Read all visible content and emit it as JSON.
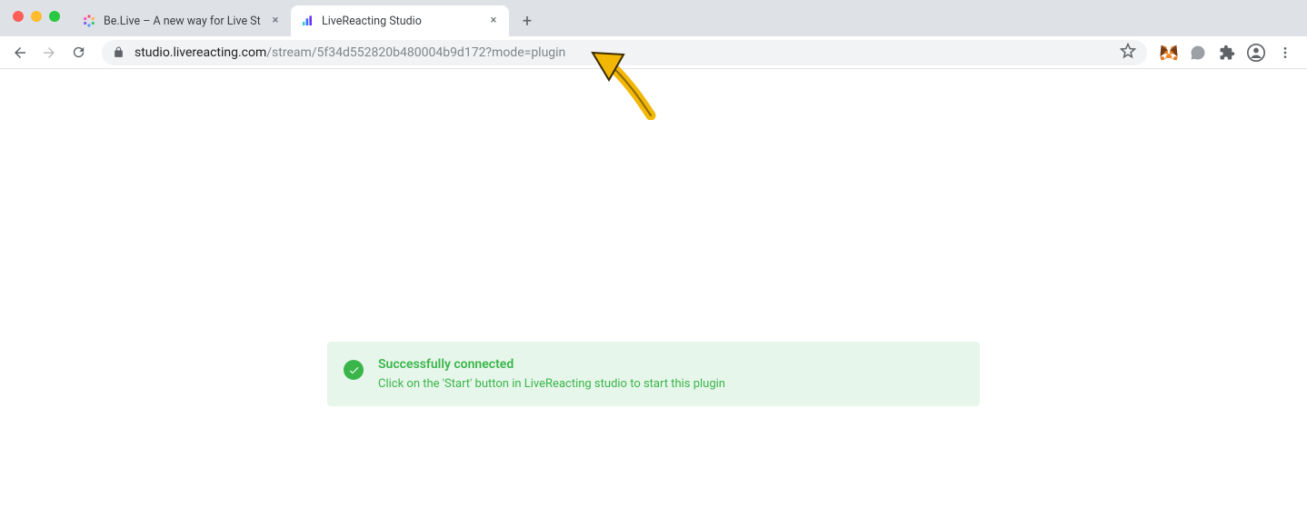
{
  "tabs": [
    {
      "title": "Be.Live – A new way for Live St",
      "active": false
    },
    {
      "title": "LiveReacting Studio",
      "active": true
    }
  ],
  "url": {
    "host": "studio.livereacting.com",
    "path": "/stream/5f34d552820b480004b9d172?mode=plugin"
  },
  "status": {
    "title": "Successfully connected",
    "subtitle": "Click on the 'Start' button in LiveReacting studio to start this plugin"
  },
  "icons": {
    "close": "×",
    "plus": "+",
    "back": "back-arrow-icon",
    "forward": "forward-arrow-icon",
    "reload": "reload-icon",
    "lock": "lock-icon",
    "star": "star-icon",
    "metamask": "metamask-icon",
    "chat": "chat-icon",
    "extensions": "puzzle-icon",
    "profile": "profile-icon",
    "menu": "kebab-icon",
    "check": "check-icon",
    "favicon_belive": "belive-favicon",
    "favicon_lr": "livereacting-favicon",
    "annotation_arrow": "annotation-arrow"
  },
  "colors": {
    "success_bg": "#e7f6ea",
    "success_fg": "#39b54a",
    "arrow": "#f2b705"
  }
}
